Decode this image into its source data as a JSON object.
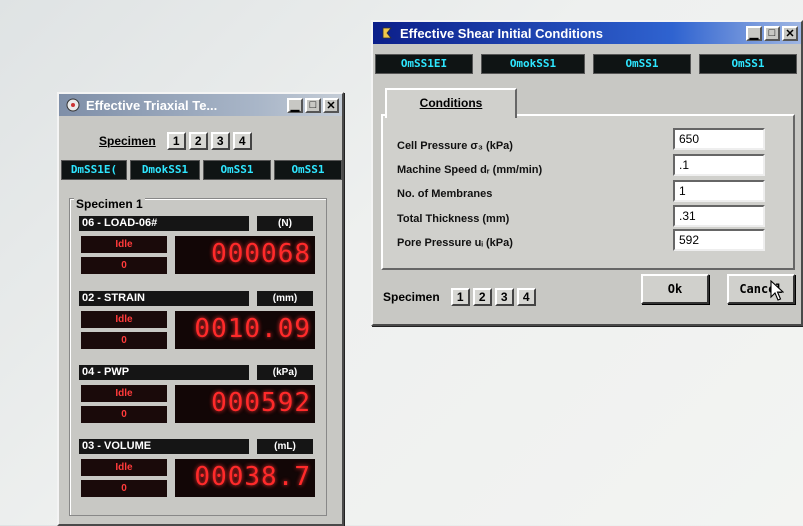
{
  "triaxial_window": {
    "title": "Effective Triaxial Te...",
    "specimen_label": "Specimen",
    "specimen_buttons": [
      "1",
      "2",
      "3",
      "4"
    ],
    "tags": [
      "DmSS1E(",
      "DmokSS1",
      "OmSS1",
      "OmSS1"
    ],
    "group_label": "Specimen 1",
    "channels": [
      {
        "name": "06 - LOAD-06#",
        "unit": "(N)",
        "state": "Idle",
        "sub": "0",
        "value": "000068"
      },
      {
        "name": "02 - STRAIN",
        "unit": "(mm)",
        "state": "Idle",
        "sub": "0",
        "value": "0010.09"
      },
      {
        "name": "04 - PWP",
        "unit": "(kPa)",
        "state": "Idle",
        "sub": "0",
        "value": "000592"
      },
      {
        "name": "03 - VOLUME",
        "unit": "(mL)",
        "state": "Idle",
        "sub": "0",
        "value": "00038.7"
      }
    ]
  },
  "shear_dialog": {
    "title": "Effective Shear Initial Conditions",
    "tags": [
      "OmSS1EI",
      "OmokSS1",
      "OmSS1",
      "OmSS1"
    ],
    "tab_label": "Conditions",
    "fields": [
      {
        "label": "Cell Pressure σ₃ (kPa)",
        "value": "650"
      },
      {
        "label": "Machine Speed dᵣ (mm/min)",
        "value": ".1"
      },
      {
        "label": "No. of Membranes",
        "value": "1"
      },
      {
        "label": "Total Thickness (mm)",
        "value": ".31"
      },
      {
        "label": "Pore Pressure uᵢ (kPa)",
        "value": "592"
      }
    ],
    "specimen_label": "Specimen",
    "specimen_buttons": [
      "1",
      "2",
      "3",
      "4"
    ],
    "ok_label": "Ok",
    "cancel_label": "Cancel"
  },
  "icons": {
    "cursor": "arrow-cursor-icon",
    "app": "app-icon"
  }
}
